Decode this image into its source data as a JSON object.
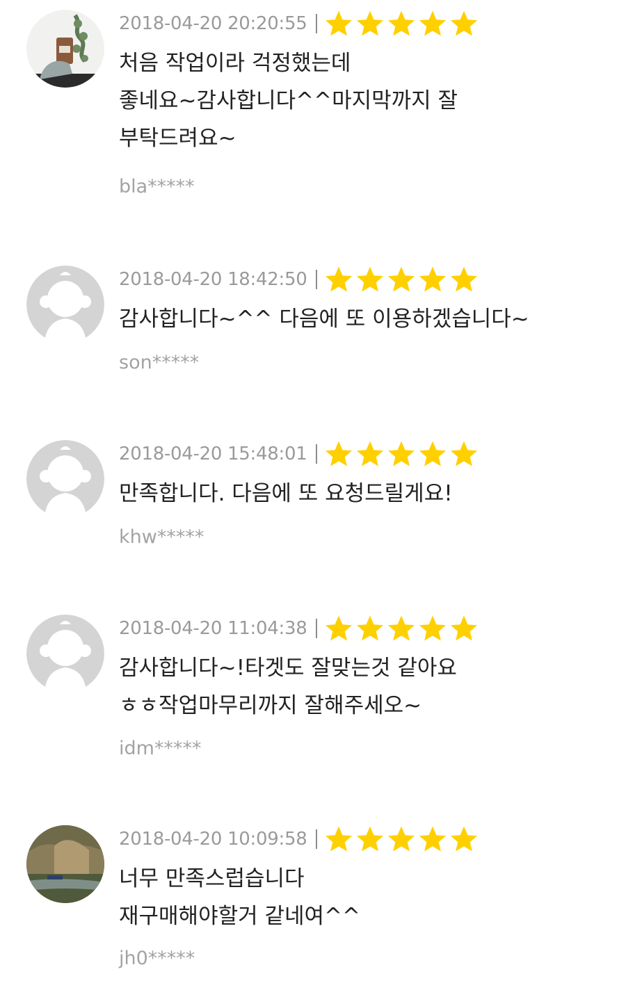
{
  "colors": {
    "star": "#ffd000",
    "date": "#9a9a9a",
    "text": "#222222",
    "user": "#a3a3a3",
    "avatar_default": "#d4d4d4"
  },
  "reviews": [
    {
      "date": "2018-04-20 20:20:55",
      "rating": 5,
      "avatar": "photo-avatar",
      "lines": [
        "처음 작업이라 걱정했는데",
        "좋네요~감사합니다^^마지막까지 잘",
        "부탁드려요~"
      ],
      "user": "bla*****"
    },
    {
      "date": "2018-04-20 18:42:50",
      "rating": 5,
      "avatar": "default-avatar",
      "lines": [
        "감사합니다~^^ 다음에 또 이용하겠습니다~"
      ],
      "user": "son*****"
    },
    {
      "date": "2018-04-20 15:48:01",
      "rating": 5,
      "avatar": "default-avatar",
      "lines": [
        "만족합니다. 다음에 또 요청드릴게요!"
      ],
      "user": "khw*****"
    },
    {
      "date": "2018-04-20 11:04:38",
      "rating": 5,
      "avatar": "default-avatar",
      "lines": [
        "감사합니다~!타겟도 잘맞는것 같아요",
        "ㅎㅎ작업마무리까지 잘해주세오~"
      ],
      "user": "idm*****"
    },
    {
      "date": "2018-04-20 10:09:58",
      "rating": 5,
      "avatar": "landscape-avatar",
      "lines": [
        "너무 만족스럽습니다",
        "재구매해야할거 같네여^^"
      ],
      "user": "jh0*****"
    }
  ]
}
